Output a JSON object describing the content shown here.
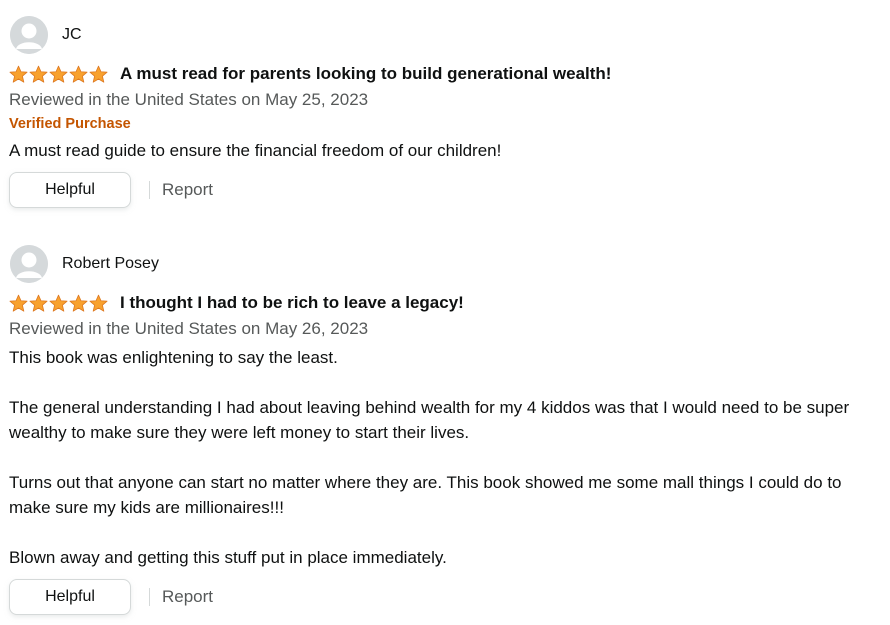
{
  "colors": {
    "star": "#f8a12e",
    "verified": "#c45500",
    "meta_text": "#565959",
    "text": "#0f1111",
    "avatar_bg": "#d5d9db"
  },
  "reviews": [
    {
      "reviewer": "JC",
      "rating": 5,
      "title": "A must read for parents looking to build generational wealth!",
      "date": "Reviewed in the United States on May 25, 2023",
      "verified_label": "Verified Purchase",
      "body": [
        "A must read guide to ensure the financial freedom of our children!"
      ],
      "helpful_label": "Helpful",
      "report_label": "Report"
    },
    {
      "reviewer": "Robert Posey",
      "rating": 5,
      "title": "I thought I had to be rich to leave a legacy!",
      "date": "Reviewed in the United States on May 26, 2023",
      "body": [
        "This book was enlightening to say the least.",
        "The general understanding I had about leaving behind wealth for my 4 kiddos was that I would need to be super wealthy to make sure they were left money to start their lives.",
        "Turns out that anyone can start no matter where they are. This book showed me some mall things I could do to make sure my kids are millionaires!!!",
        "Blown away and getting this stuff put in place immediately."
      ],
      "helpful_label": "Helpful",
      "report_label": "Report"
    }
  ]
}
